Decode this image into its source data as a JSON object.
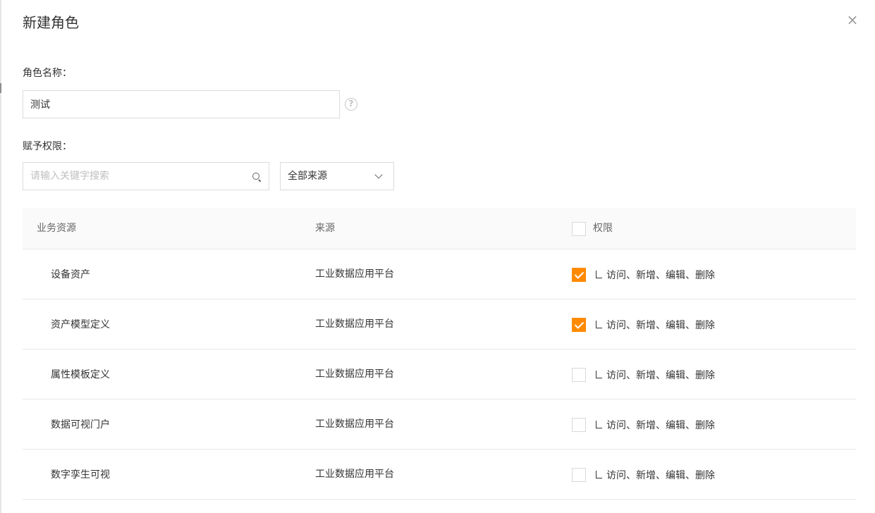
{
  "dialog": {
    "title": "新建角色",
    "close_label": "×"
  },
  "role_name": {
    "label": "角色名称：",
    "value": "测试",
    "help_icon": "?"
  },
  "permissions": {
    "label": "赋予权限：",
    "search_placeholder": "请输入关键字搜索",
    "source_select": "全部来源"
  },
  "table": {
    "headers": {
      "resource": "业务资源",
      "source": "来源",
      "permission": "权限"
    },
    "header_checked": false,
    "rows": [
      {
        "resource": "设备资产",
        "source": "工业数据应用平台",
        "permissions": "访问、新增、编辑、删除",
        "checked": true
      },
      {
        "resource": "资产模型定义",
        "source": "工业数据应用平台",
        "permissions": "访问、新增、编辑、删除",
        "checked": true
      },
      {
        "resource": "属性模板定义",
        "source": "工业数据应用平台",
        "permissions": "访问、新增、编辑、删除",
        "checked": false
      },
      {
        "resource": "数据可视门户",
        "source": "工业数据应用平台",
        "permissions": "访问、新增、编辑、删除",
        "checked": false
      },
      {
        "resource": "数字孪生可视",
        "source": "工业数据应用平台",
        "permissions": "访问、新增、编辑、删除",
        "checked": false
      }
    ]
  },
  "colors": {
    "accent": "#ff8a00"
  }
}
